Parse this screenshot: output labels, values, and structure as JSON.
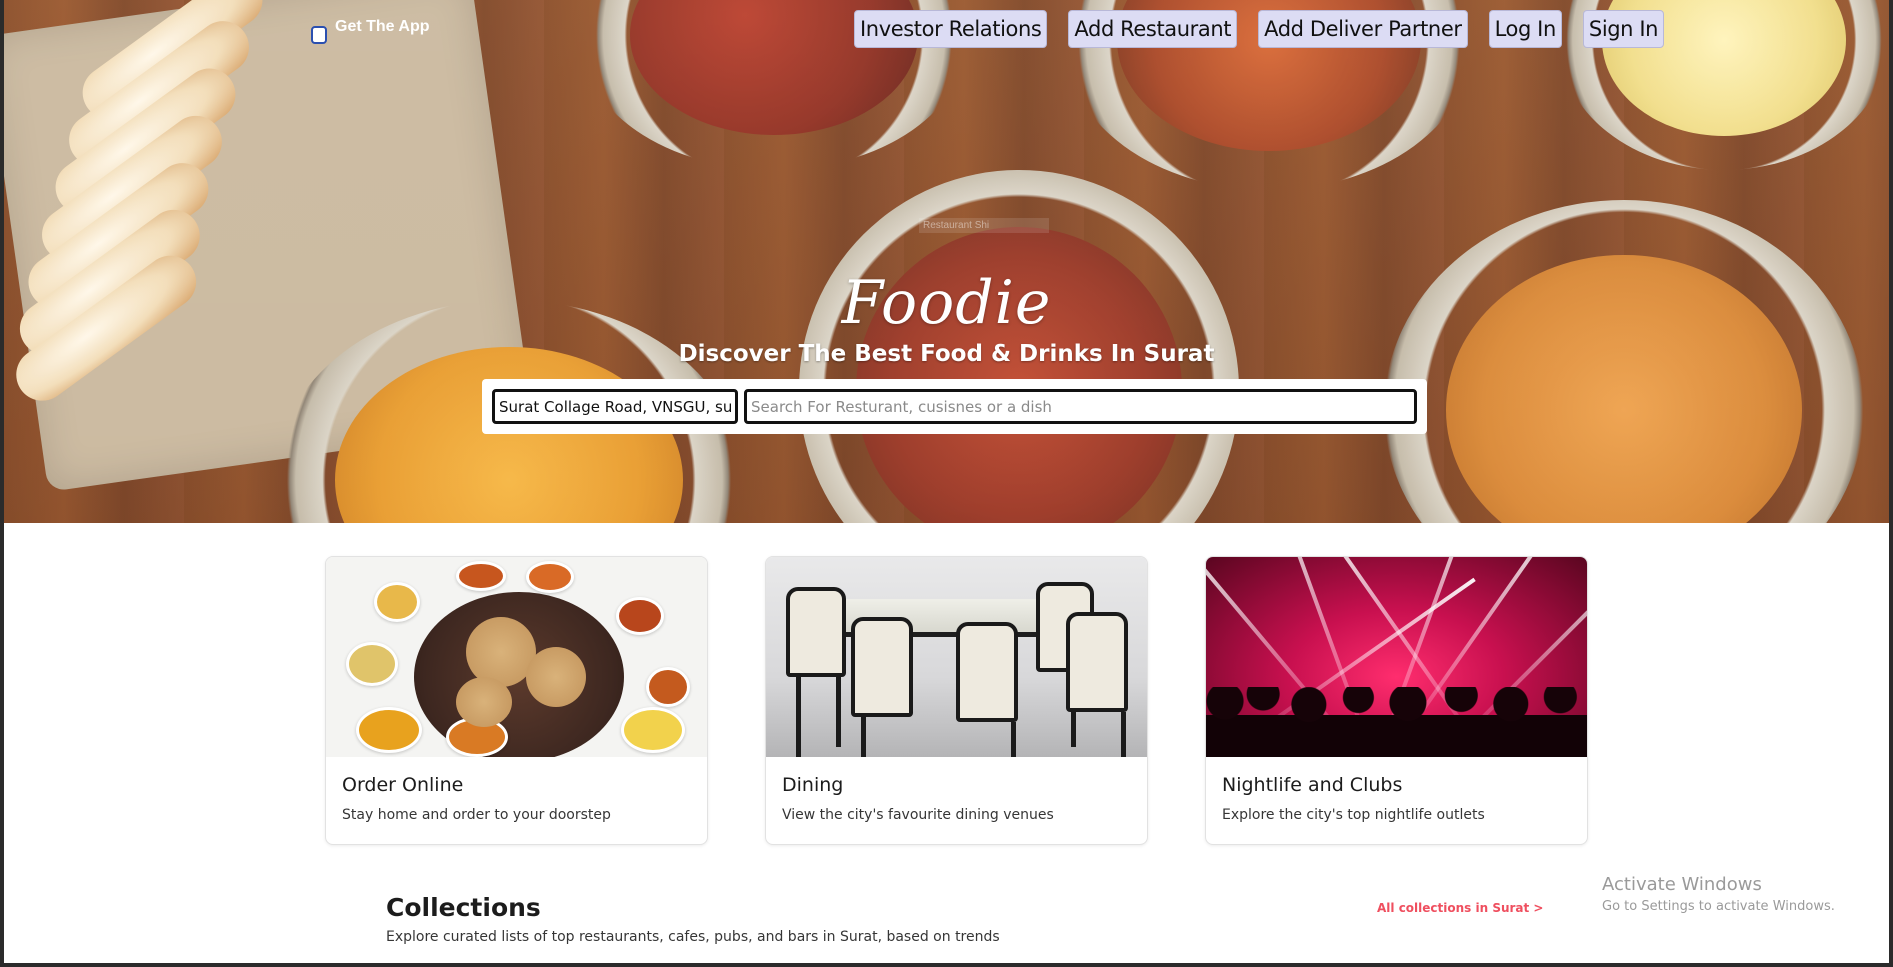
{
  "hero": {
    "get_app_label": "Get The App",
    "nav": [
      "Investor Relations",
      "Add Restaurant",
      "Add Deliver Partner",
      "Log In",
      "Sign In"
    ],
    "ghost_text": "Restaurant Shi",
    "logo_text": "Foodie",
    "headline": "Discover The Best Food & Drinks In Surat",
    "search": {
      "location_value": "Surat Collage Road, VNSGU, surat",
      "dish_placeholder": "Search For Resturant, cusisnes or a dish"
    }
  },
  "cards": [
    {
      "title": "Order Online",
      "desc": "Stay home and order to your doorstep",
      "image": "indian-thali-photo"
    },
    {
      "title": "Dining",
      "desc": "View the city's favourite dining venues",
      "image": "dining-table-photo"
    },
    {
      "title": "Nightlife and Clubs",
      "desc": "Explore the city's top nightlife outlets",
      "image": "concert-lights-photo"
    }
  ],
  "collections": {
    "title": "Collections",
    "subtitle": "Explore curated lists of top restaurants, cafes, pubs, and bars in Surat, based on trends",
    "link": "All collections in Surat >"
  },
  "watermark": {
    "line1": "Activate Windows",
    "line2": "Go to Settings to activate Windows."
  },
  "colors": {
    "accent": "#ef4f5f",
    "nav_button_bg": "#dcdcf4",
    "text_dark": "#1c1c1c"
  }
}
